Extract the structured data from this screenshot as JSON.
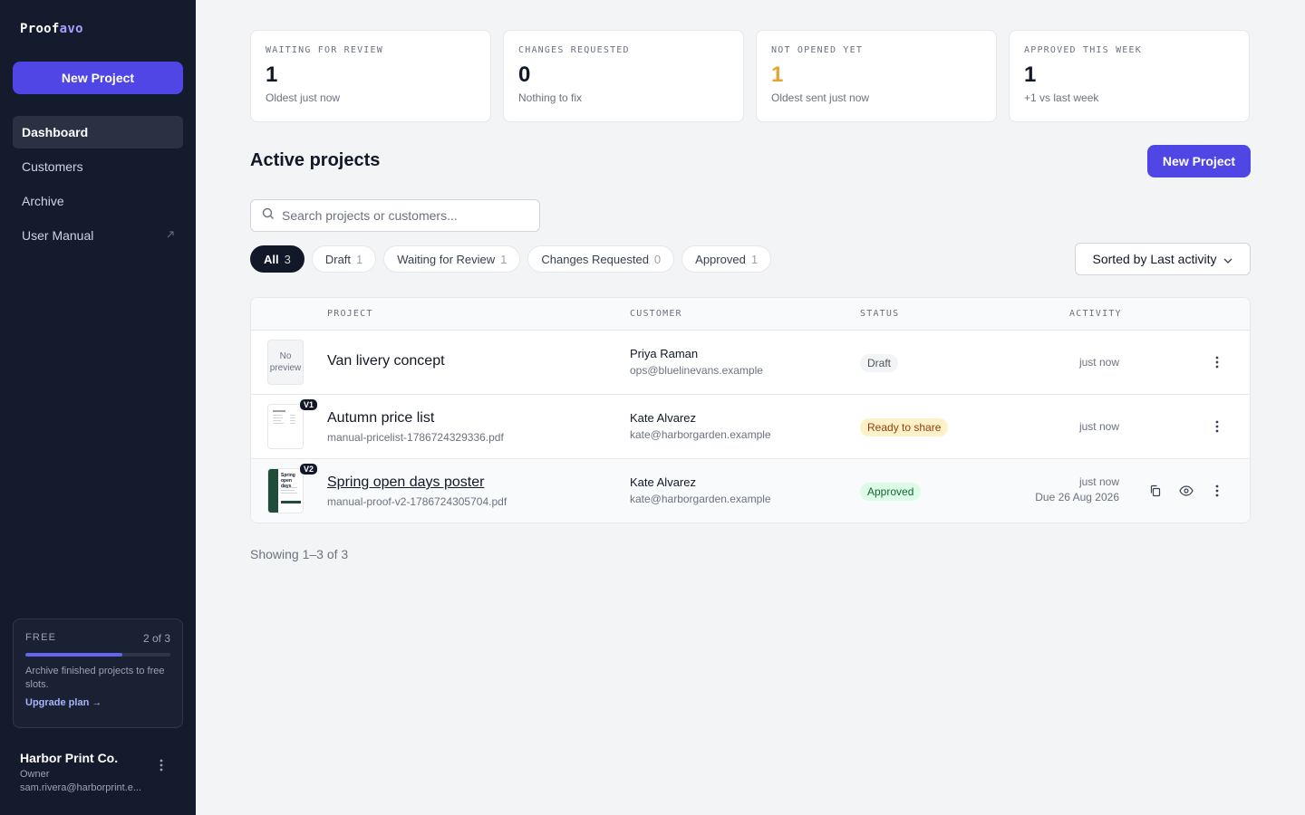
{
  "app": {
    "brand_prefix": "Proof",
    "brand_suffix": "avo",
    "accent": "#4f46e5"
  },
  "sidebar": {
    "new_project": "New Project",
    "nav": [
      {
        "label": "Dashboard",
        "active": true
      },
      {
        "label": "Customers"
      },
      {
        "label": "Archive"
      },
      {
        "label": "User Manual",
        "icon": "external-link-icon"
      }
    ],
    "plan": {
      "tier": "FREE",
      "usage": "2 of 3",
      "used": 2,
      "limit": 3,
      "note": "Archive finished projects to free slots.",
      "upgrade": "Upgrade plan →"
    },
    "account": {
      "name": "Harbor Print Co.",
      "role": "Owner",
      "email": "sam.rivera@harborprint.e..."
    }
  },
  "stats": [
    {
      "label": "WAITING FOR REVIEW",
      "value": "1",
      "sub": "Oldest just now"
    },
    {
      "label": "CHANGES REQUESTED",
      "value": "0",
      "sub": "Nothing to fix"
    },
    {
      "label": "NOT OPENED YET",
      "value": "1",
      "sub": "Oldest sent just now",
      "color": "#e0a534"
    },
    {
      "label": "APPROVED THIS WEEK",
      "value": "1",
      "sub": "+1 vs last week"
    }
  ],
  "main": {
    "title": "Active projects",
    "new_project": "New Project",
    "search_placeholder": "Search projects or customers...",
    "filters": [
      {
        "label": "All",
        "count": "3",
        "active": true
      },
      {
        "label": "Draft",
        "count": "1"
      },
      {
        "label": "Waiting for Review",
        "count": "1"
      },
      {
        "label": "Changes Requested",
        "count": "0"
      },
      {
        "label": "Approved",
        "count": "1"
      }
    ],
    "sort": "Sorted by Last activity",
    "showing": "Showing 1–3 of 3"
  },
  "table": {
    "headers": {
      "project": "PROJECT",
      "customer": "CUSTOMER",
      "status": "STATUS",
      "activity": "ACTIVITY"
    },
    "rows": [
      {
        "thumb": "No preview",
        "version": "",
        "name": "Van livery concept",
        "file": "",
        "customer": "Priya Raman",
        "email": "ops@bluelinevans.example",
        "status": "Draft",
        "status_kind": "draft",
        "activity": "just now",
        "due": ""
      },
      {
        "thumb": "",
        "version": "V1",
        "name": "Autumn price list",
        "file": "manual-pricelist-1786724329336.pdf",
        "customer": "Kate Alvarez",
        "email": "kate@harborgarden.example",
        "status": "Ready to share",
        "status_kind": "ready",
        "activity": "just now",
        "due": ""
      },
      {
        "thumb": "",
        "version": "V2",
        "name": "Spring open days poster",
        "file": "manual-proof-v2-1786724305704.pdf",
        "customer": "Kate Alvarez",
        "email": "kate@harborgarden.example",
        "status": "Approved",
        "status_kind": "approved",
        "activity": "just now",
        "due": "Due 26 Aug 2026"
      }
    ]
  },
  "thumb_text": {
    "poster_line1": "Spring",
    "poster_line2": "open days"
  }
}
